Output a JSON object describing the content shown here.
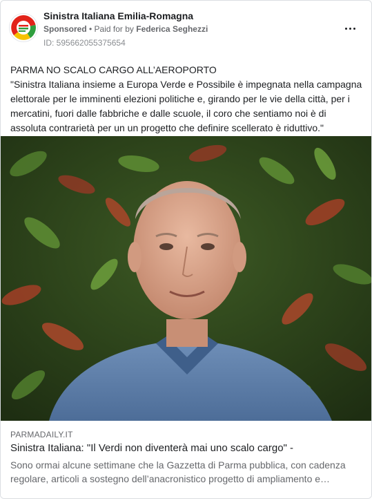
{
  "post": {
    "page_name": "Sinistra Italiana Emilia-Romagna",
    "sponsored_label": "Sponsored",
    "separator": " • ",
    "paid_for_label": "Paid for by ",
    "payer": "Federica Seghezzi",
    "ad_id": "ID: 595662055375654",
    "more_icon": "more-horizontal-icon",
    "body_title": "PARMA NO SCALO CARGO ALL’AEROPORTO",
    "body_quote": "\"Sinistra Italiana insieme a Europa Verde e Possibile è impegnata nella campagna elettorale per le imminenti elezioni politiche e, girando per le vie della città, per i mercatini, fuori dalle fabbriche e dalle scuole, il coro che sentiamo noi è di assoluta contrarietà per un un progetto che definire scellerato è riduttivo.\""
  },
  "avatar": {
    "logo_text": "Sinistra Italiana Verdi"
  },
  "link_preview": {
    "domain": "PARMADAILY.IT",
    "title": "Sinistra Italiana: \"Il Verdi non diventerà mai uno scalo cargo\" -",
    "description": "Sono ormai alcune settimane che la Gazzetta di Parma pubblica, con cadenza regolare, articoli a sostegno dell’anacronistico progetto di ampliamento e…"
  },
  "colors": {
    "accent_red": "#e2231a",
    "accent_green": "#2e9e3e",
    "accent_yellow": "#f6c200",
    "text_primary": "#1c1e21",
    "text_secondary": "#65676b"
  }
}
